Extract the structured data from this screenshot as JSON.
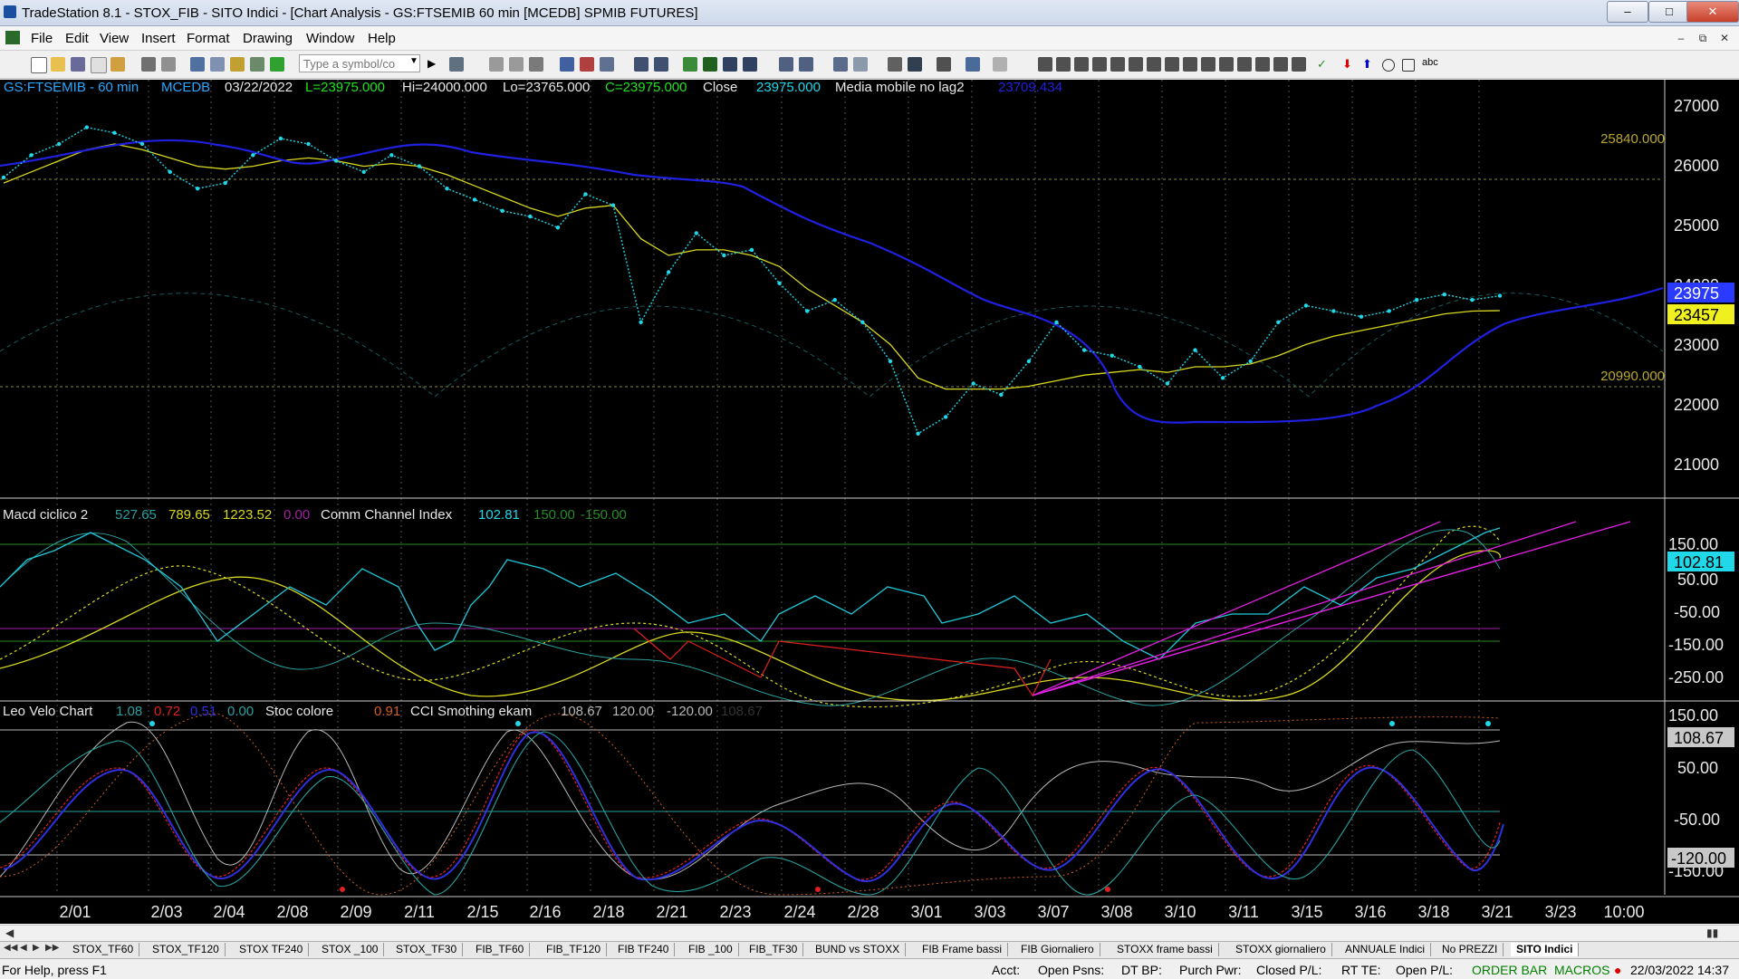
{
  "window": {
    "title": "TradeStation 8.1 - STOX_FIB - SITO Indici - [Chart Analysis - GS:FTSEMIB  60 min  [MCEDB] SPMIB FUTURES]"
  },
  "menu": [
    "File",
    "Edit",
    "View",
    "Insert",
    "Format",
    "Drawing",
    "Window",
    "Help"
  ],
  "toolbar": {
    "symbol_placeholder": "Type a symbol/co"
  },
  "price_header": {
    "symbol": "GS:FTSEMIB - 60 min",
    "exchange": "MCEDB",
    "date": "03/22/2022",
    "last": "L=23975.000",
    "high": "Hi=24000.000",
    "low": "Lo=23765.000",
    "close_eq": "C=23975.000",
    "close_label": "Close",
    "close_value": "23975.000",
    "ma_label": "Media mobile no lag2",
    "ma_value": "23709.434"
  },
  "price_axis_labels": [
    "27000",
    "26000",
    "25000",
    "24000",
    "23000",
    "22000",
    "21000"
  ],
  "price_levels": {
    "upper": "25840.000",
    "lower": "20990.000"
  },
  "price_tags": {
    "last": "23975",
    "ma": "23457"
  },
  "macd_header": {
    "name": "Macd ciclico 2",
    "v1": "527.65",
    "v2": "789.65",
    "v3": "1223.52",
    "v4": "0.00",
    "cci_name": "Comm Channel Index",
    "cci_value": "102.81",
    "cci_upper": "150.00",
    "cci_lower": "-150.00"
  },
  "macd_axis_labels": [
    "150.00",
    "50.00",
    "-50.00",
    "-150.00",
    "-250.00"
  ],
  "macd_tag": "102.81",
  "velo_header": {
    "name": "Leo Velo Chart",
    "v1": "1.08",
    "v2": "0.72",
    "v3": "0.51",
    "v4": "0.00",
    "stoc_name": "Stoc colore",
    "stoc_value": "0.91",
    "cci_name": "CCI Smothing ekam",
    "cci_value": "108.67",
    "cci_upper": "120.00",
    "cci_lower": "-120.00",
    "ghost": "108.67"
  },
  "velo_axis_labels": [
    "150.00",
    "50.00",
    "-50.00",
    "-150.00"
  ],
  "velo_tags": {
    "top": "108.67",
    "bottom": "-120.00"
  },
  "date_labels": [
    "2/01",
    "2/03",
    "2/04",
    "2/08",
    "2/09",
    "2/11",
    "2/15",
    "2/16",
    "2/18",
    "2/21",
    "2/23",
    "2/24",
    "2/28",
    "3/01",
    "3/03",
    "3/07",
    "3/08",
    "3/10",
    "3/11",
    "3/15",
    "3/16",
    "3/18",
    "3/21",
    "3/23",
    "10:00"
  ],
  "chart_data": {
    "type": "line",
    "title": "GS:FTSEMIB - 60 min",
    "series": [
      {
        "name": "Close",
        "values": [
          26100,
          26500,
          26700,
          27000,
          26900,
          26700,
          26200,
          25900,
          26000,
          26500,
          26800,
          26700,
          26400,
          26200,
          26500,
          26300,
          25900,
          25700,
          25500,
          25400,
          25200,
          25800,
          25600,
          23500,
          24400,
          25100,
          24700,
          24800,
          24200,
          23700,
          23900,
          23500,
          22800,
          21500,
          21800,
          22400,
          22200,
          22800,
          23500,
          23000,
          22900,
          22700,
          22400,
          23000,
          22500,
          22800,
          23500,
          23800,
          23700,
          23600,
          23700,
          23900,
          24000,
          23900,
          23975
        ]
      },
      {
        "name": "Media mobile no lag2",
        "values": [
          26000,
          26200,
          26400,
          26600,
          26700,
          26600,
          26450,
          26300,
          26250,
          26300,
          26400,
          26450,
          26400,
          26300,
          26350,
          26300,
          26150,
          25950,
          25750,
          25550,
          25400,
          25550,
          25600,
          25000,
          24700,
          24800,
          24800,
          24700,
          24500,
          24100,
          23800,
          23500,
          23100,
          22500,
          22300,
          22300,
          22300,
          22350,
          22450,
          22550,
          22600,
          22650,
          22600,
          22700,
          22700,
          22750,
          22900,
          23100,
          23250,
          23350,
          23450,
          23550,
          23650,
          23700,
          23709
        ]
      }
    ],
    "ylim": [
      20700,
      27400
    ],
    "yticks": [
      21000,
      22000,
      23000,
      24000,
      25000,
      26000,
      27000
    ]
  }
}
